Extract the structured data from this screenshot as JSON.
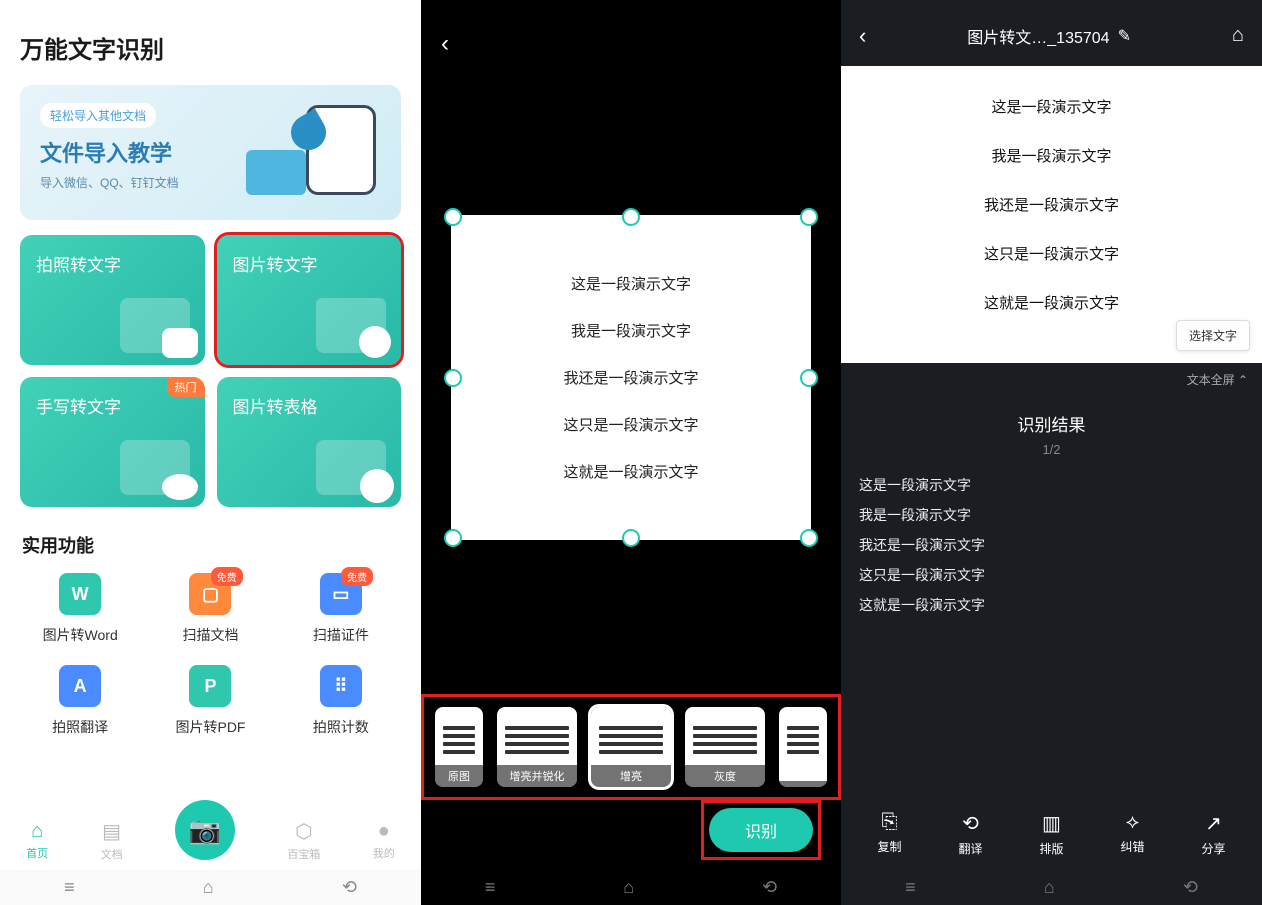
{
  "panel1": {
    "app_title": "万能文字识别",
    "import_card": {
      "badge": "轻松导入其他文档",
      "title": "文件导入教学",
      "subtitle": "导入微信、QQ、钉钉文档"
    },
    "tiles": [
      {
        "label": "拍照转文字"
      },
      {
        "label": "图片转文字"
      },
      {
        "label": "手写转文字",
        "badge": "热门"
      },
      {
        "label": "图片转表格"
      }
    ],
    "section_title": "实用功能",
    "tools": [
      {
        "label": "图片转Word",
        "color": "#2fc7ad",
        "glyph": "W"
      },
      {
        "label": "扫描文档",
        "color": "#ff8a3d",
        "glyph": "▢",
        "badge": "免费"
      },
      {
        "label": "扫描证件",
        "color": "#4a8cff",
        "glyph": "▭",
        "badge": "免费"
      },
      {
        "label": "拍照翻译",
        "color": "#4a8cff",
        "glyph": "A"
      },
      {
        "label": "图片转PDF",
        "color": "#2fc7ad",
        "glyph": "P"
      },
      {
        "label": "拍照计数",
        "color": "#4a8cff",
        "glyph": "⠿"
      }
    ],
    "nav": [
      {
        "label": "首页",
        "icon": "⌂"
      },
      {
        "label": "文档",
        "icon": "▤"
      },
      {
        "label": "百宝箱",
        "icon": "⬡"
      },
      {
        "label": "我的",
        "icon": "●"
      }
    ]
  },
  "panel2": {
    "sample_lines": [
      "这是一段演示文字",
      "我是一段演示文字",
      "我还是一段演示文字",
      "这只是一段演示文字",
      "这就是一段演示文字"
    ],
    "filters": [
      {
        "label": "原图"
      },
      {
        "label": "增亮并锐化"
      },
      {
        "label": "增亮",
        "selected": true
      },
      {
        "label": "灰度"
      },
      {
        "label": ""
      }
    ],
    "recognize_button": "识别"
  },
  "panel3": {
    "header_title": "图片转文…_135704",
    "preview_lines": [
      "这是一段演示文字",
      "我是一段演示文字",
      "我还是一段演示文字",
      "这只是一段演示文字",
      "这就是一段演示文字"
    ],
    "select_text_button": "选择文字",
    "fullscreen_label": "文本全屏",
    "result_title": "识别结果",
    "result_page": "1/2",
    "result_lines": [
      "这是一段演示文字",
      "我是一段演示文字",
      "我还是一段演示文字",
      "这只是一段演示文字",
      "这就是一段演示文字"
    ],
    "actions": [
      {
        "label": "复制",
        "icon": "⎘"
      },
      {
        "label": "翻译",
        "icon": "⟲"
      },
      {
        "label": "排版",
        "icon": "▥"
      },
      {
        "label": "纠错",
        "icon": "⟡"
      },
      {
        "label": "分享",
        "icon": "↗"
      }
    ]
  },
  "sysnav": {
    "menu": "≡",
    "home": "⌂",
    "back": "⟲"
  }
}
